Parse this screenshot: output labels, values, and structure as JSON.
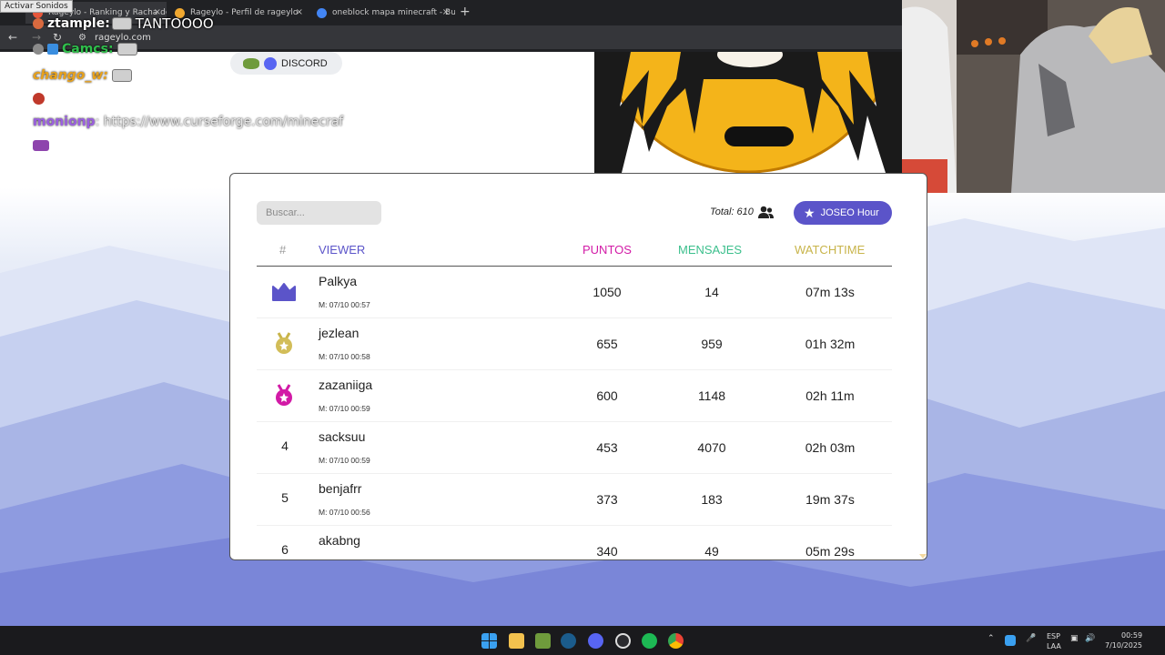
{
  "overlay": {
    "activar_label": "Activar Sonidos"
  },
  "browser": {
    "tabs": [
      {
        "title": "Rageylo - Ranking y Racha de",
        "fav_color": "#e7573b"
      },
      {
        "title": "Rageylo - Perfil de rageylo",
        "fav_color": "#f0a830"
      },
      {
        "title": "oneblock mapa minecraft - Bus",
        "fav_color": "#4285f4"
      }
    ],
    "new_tab_icon": "+",
    "close_icon": "×",
    "url": "rageylo.com"
  },
  "chat": [
    {
      "user": "ztample:",
      "user_color": "#ffffff",
      "text": "TANTOOOO"
    },
    {
      "user": "Camcs:",
      "user_color": "#2fbf4b",
      "text": ""
    },
    {
      "user": "chango_w:",
      "user_color": "#e9a21c",
      "text": ""
    },
    {
      "user": "monionp",
      "user_color": "#9b5fe0",
      "text": ": https://www.curseforge.com/minecraf"
    }
  ],
  "discord": {
    "label": "DISCORD"
  },
  "search": {
    "placeholder": "Buscar..."
  },
  "total": {
    "label": "Total: 610"
  },
  "joseo": {
    "label": "JOSEO Hour"
  },
  "table": {
    "headers": {
      "rank": "#",
      "viewer": "VIEWER",
      "puntos": "PUNTOS",
      "mensajes": "MENSAJES",
      "watchtime": "WATCHTIME"
    },
    "header_colors": {
      "rank": "#999999",
      "viewer": "#5b54c9",
      "puntos": "#d21aa6",
      "mensajes": "#3bbf8c",
      "watchtime": "#c8b44a"
    },
    "rows": [
      {
        "rank": "",
        "name": "Palkya",
        "date": "M: 07/10 00:57",
        "puntos": "1050",
        "mensajes": "14",
        "watchtime": "07m 13s"
      },
      {
        "rank": "",
        "name": "jezlean",
        "date": "M: 07/10 00:58",
        "puntos": "655",
        "mensajes": "959",
        "watchtime": "01h 32m"
      },
      {
        "rank": "",
        "name": "zazaniiga",
        "date": "M: 07/10 00:59",
        "puntos": "600",
        "mensajes": "1148",
        "watchtime": "02h 11m"
      },
      {
        "rank": "4",
        "name": "sacksuu",
        "date": "M: 07/10 00:59",
        "puntos": "453",
        "mensajes": "4070",
        "watchtime": "02h 03m"
      },
      {
        "rank": "5",
        "name": "benjafrr",
        "date": "M: 07/10 00:56",
        "puntos": "373",
        "mensajes": "183",
        "watchtime": "19m 37s"
      },
      {
        "rank": "6",
        "name": "akabng",
        "date": "",
        "puntos": "340",
        "mensajes": "49",
        "watchtime": "05m 29s"
      }
    ]
  },
  "taskbar": {
    "lang_top": "ESP",
    "lang_bottom": "LAA",
    "time": "00:59",
    "date": "7/10/2025",
    "icons": [
      "windows-icon",
      "folder-icon",
      "minecraft-icon",
      "steam-icon",
      "discord-icon",
      "obs-icon",
      "spotify-icon",
      "chrome-icon"
    ]
  }
}
